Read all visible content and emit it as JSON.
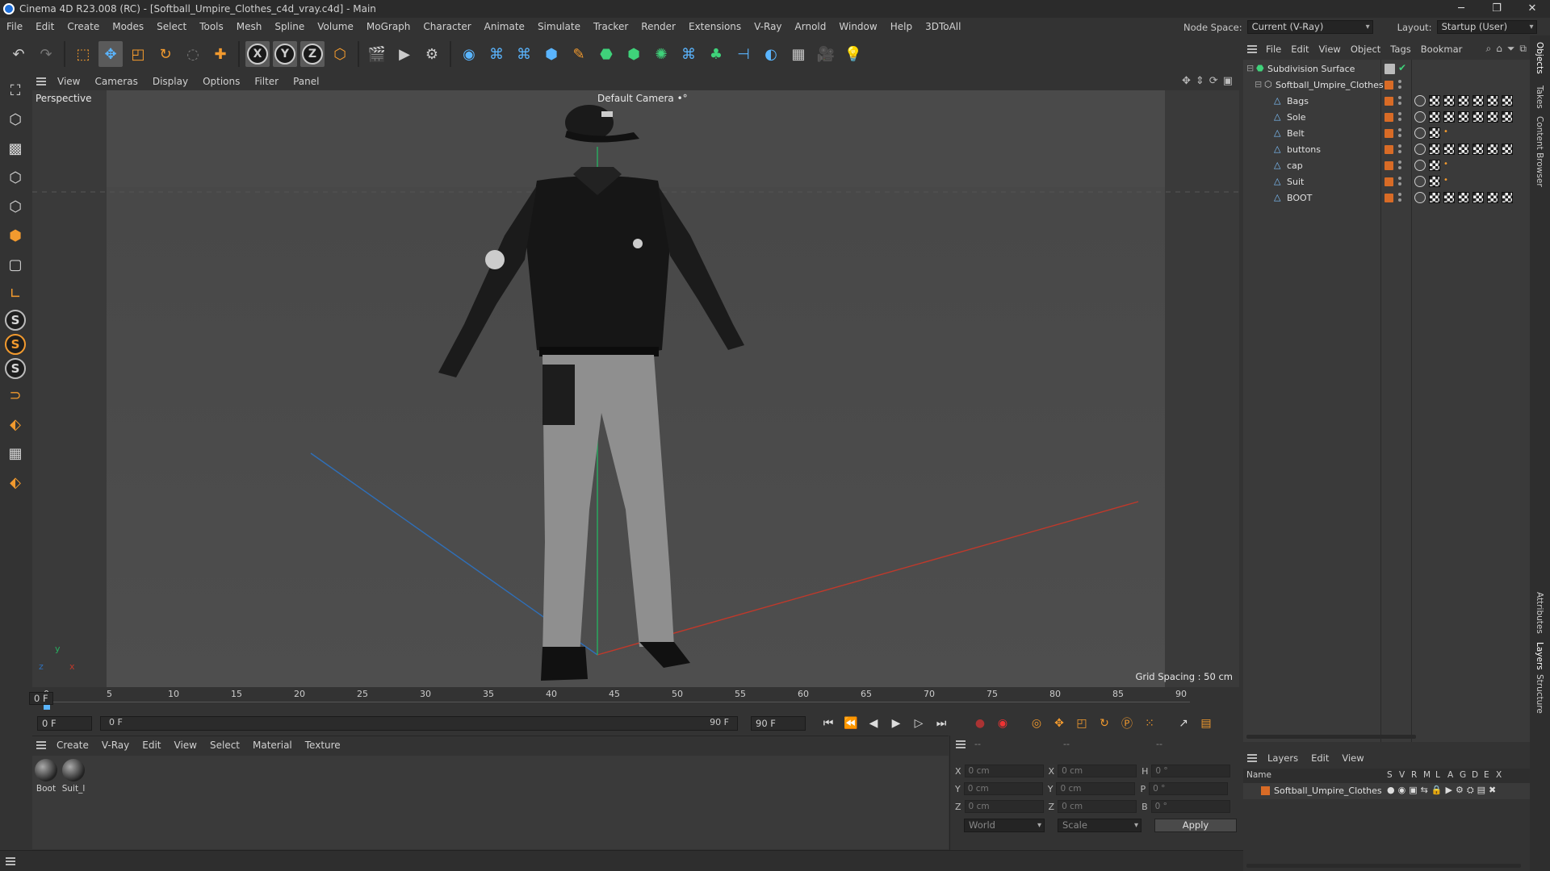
{
  "window": {
    "title": "Cinema 4D R23.008 (RC) - [Softball_Umpire_Clothes_c4d_vray.c4d] - Main",
    "min": "─",
    "max": "❐",
    "close": "✕"
  },
  "menu": [
    "File",
    "Edit",
    "Create",
    "Modes",
    "Select",
    "Tools",
    "Mesh",
    "Spline",
    "Volume",
    "MoGraph",
    "Character",
    "Animate",
    "Simulate",
    "Tracker",
    "Render",
    "Extensions",
    "V-Ray",
    "Arnold",
    "Window",
    "Help",
    "3DToAll"
  ],
  "node_space": {
    "label": "Node Space:",
    "value": "Current (V-Ray)"
  },
  "layout": {
    "label": "Layout:",
    "value": "Startup (User)"
  },
  "viewport_menu": [
    "View",
    "Cameras",
    "Display",
    "Options",
    "Filter",
    "Panel"
  ],
  "viewport": {
    "name": "Perspective",
    "camera": "Default Camera",
    "camera_icon": "•°",
    "grid": "Grid Spacing : 50 cm",
    "axis_y": "y",
    "axis_z": "z",
    "axis_x": "x"
  },
  "timeline": {
    "ticks": [
      "0",
      "5",
      "10",
      "15",
      "20",
      "25",
      "30",
      "35",
      "40",
      "45",
      "50",
      "55",
      "60",
      "65",
      "70",
      "75",
      "80",
      "85",
      "90"
    ],
    "current": "0 F"
  },
  "transport": {
    "start": "0 F",
    "slider_start": "0 F",
    "slider_end": "90 F",
    "end": "90 F"
  },
  "material_menu": [
    "Create",
    "V-Ray",
    "Edit",
    "View",
    "Select",
    "Material",
    "Texture"
  ],
  "materials": [
    "Boot",
    "Suit_l"
  ],
  "coords": {
    "x_pos": "0 cm",
    "y_pos": "0 cm",
    "z_pos": "0 cm",
    "x_size": "0 cm",
    "y_size": "0 cm",
    "z_size": "0 cm",
    "h": "0 °",
    "p": "0 °",
    "b": "0 °",
    "labels": {
      "x": "X",
      "y": "Y",
      "z": "Z",
      "h": "H",
      "p": "P",
      "b": "B"
    },
    "space": "World",
    "mode": "Scale",
    "apply": "Apply",
    "dashes": "--"
  },
  "objects_menu": [
    "File",
    "Edit",
    "View",
    "Object",
    "Tags",
    "Bookmar"
  ],
  "objects": [
    {
      "name": "Subdivision Surface",
      "level": 0
    },
    {
      "name": "Softball_Umpire_Clothes",
      "level": 1
    },
    {
      "name": "Bags",
      "level": 2
    },
    {
      "name": "Sole",
      "level": 2
    },
    {
      "name": "Belt",
      "level": 2
    },
    {
      "name": "buttons",
      "level": 2
    },
    {
      "name": "cap",
      "level": 2
    },
    {
      "name": "Suit",
      "level": 2
    },
    {
      "name": "BOOT",
      "level": 2
    }
  ],
  "layers_menu": [
    "Layers",
    "Edit",
    "View"
  ],
  "layers_header": {
    "name": "Name",
    "cols": [
      "S",
      "V",
      "R",
      "M",
      "L",
      "A",
      "G",
      "D",
      "E",
      "X"
    ]
  },
  "layers": [
    {
      "name": "Softball_Umpire_Clothes",
      "color": "#d86b26"
    }
  ],
  "side_tabs": [
    "Objects",
    "Takes",
    "Content Browser",
    "Attributes",
    "Layers",
    "Structure"
  ],
  "colors": {
    "accent": "#d86b26",
    "axis_x": "#c0392b",
    "axis_y": "#27ae60",
    "axis_z": "#2f6fb8"
  }
}
